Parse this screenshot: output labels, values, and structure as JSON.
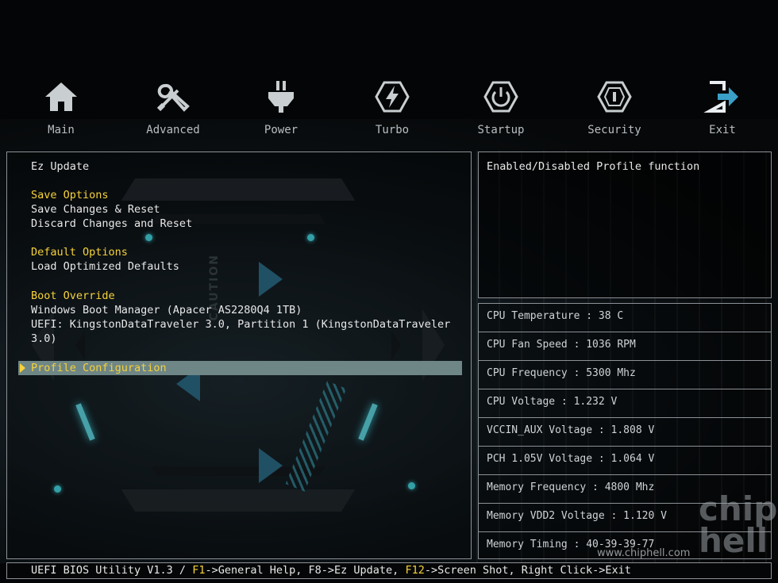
{
  "nav": {
    "tabs": [
      {
        "label": "Main",
        "icon": "home-icon"
      },
      {
        "label": "Advanced",
        "icon": "tools-icon"
      },
      {
        "label": "Power",
        "icon": "power-plug-icon"
      },
      {
        "label": "Turbo",
        "icon": "lightning-icon"
      },
      {
        "label": "Startup",
        "icon": "power-button-icon"
      },
      {
        "label": "Security",
        "icon": "shield-icon"
      },
      {
        "label": "Exit",
        "icon": "exit-icon"
      }
    ],
    "active_tab": "Exit"
  },
  "menu": {
    "ez_update": "Ez Update",
    "save_options": {
      "header": "Save Options",
      "items": [
        "Save Changes & Reset",
        "Discard Changes and Reset"
      ]
    },
    "default_options": {
      "header": "Default Options",
      "items": [
        "Load Optimized Defaults"
      ]
    },
    "boot_override": {
      "header": "Boot Override",
      "items": [
        "Windows Boot Manager (Apacer AS2280Q4 1TB)",
        "UEFI: KingstonDataTraveler 3.0, Partition 1 (KingstonDataTraveler",
        "3.0)"
      ]
    },
    "selected_item": "Profile Configuration"
  },
  "help": {
    "text": "Enabled/Disabled Profile function"
  },
  "status": [
    "CPU Temperature : 38 C",
    "CPU Fan Speed : 1036 RPM",
    "CPU Frequency : 5300 Mhz",
    "CPU Voltage : 1.232 V",
    "VCCIN_AUX Voltage : 1.808 V",
    "PCH 1.05V Voltage : 1.064 V",
    "Memory Frequency : 4800 Mhz",
    "Memory VDD2 Voltage : 1.120 V",
    "Memory Timing : 40-39-39-77"
  ],
  "bottom_bar": {
    "prefix": "UEFI BIOS Utility V1.3 / ",
    "f1": "F1",
    "f1_text": "->General Help, F8->Ez Update, ",
    "f12": "F12",
    "f12_text": "->Screen Shot, Right Click->Exit"
  },
  "watermark": {
    "logo": "chip hell",
    "url": "www.chiphell.com"
  },
  "background_text": "CAUTION",
  "colors": {
    "highlight": "#f6d23a",
    "selection": "#6e8686",
    "accent_glow": "#45d4df",
    "border": "#8c9196"
  }
}
